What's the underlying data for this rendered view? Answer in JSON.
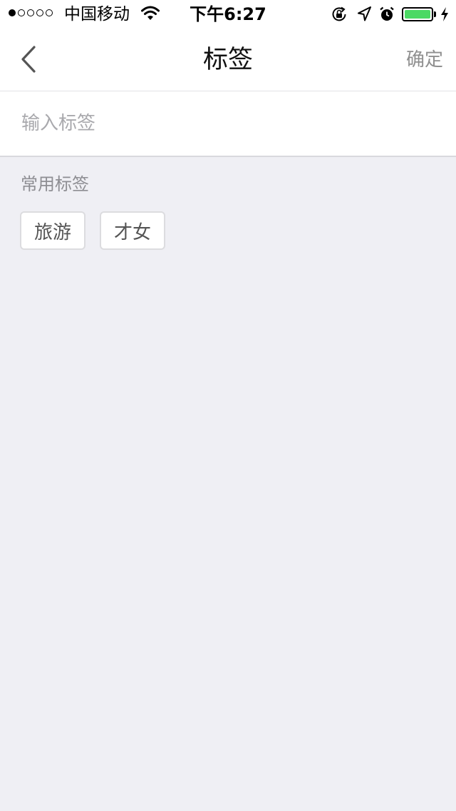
{
  "status_bar": {
    "carrier": "中国移动",
    "time": "下午6:27",
    "signal_filled": 1,
    "signal_total": 5,
    "battery_level": 1.0,
    "battery_color": "#4cd964",
    "icons": [
      "wifi-icon",
      "orientation-lock-icon",
      "location-arrow-icon",
      "alarm-icon",
      "battery-icon",
      "charging-bolt-icon"
    ]
  },
  "nav": {
    "title": "标签",
    "confirm_label": "确定",
    "back_icon": "chevron-left-icon"
  },
  "input": {
    "value": "",
    "placeholder": "输入标签"
  },
  "common_tags": {
    "label": "常用标签",
    "items": [
      {
        "label": "旅游"
      },
      {
        "label": "才女"
      }
    ]
  }
}
